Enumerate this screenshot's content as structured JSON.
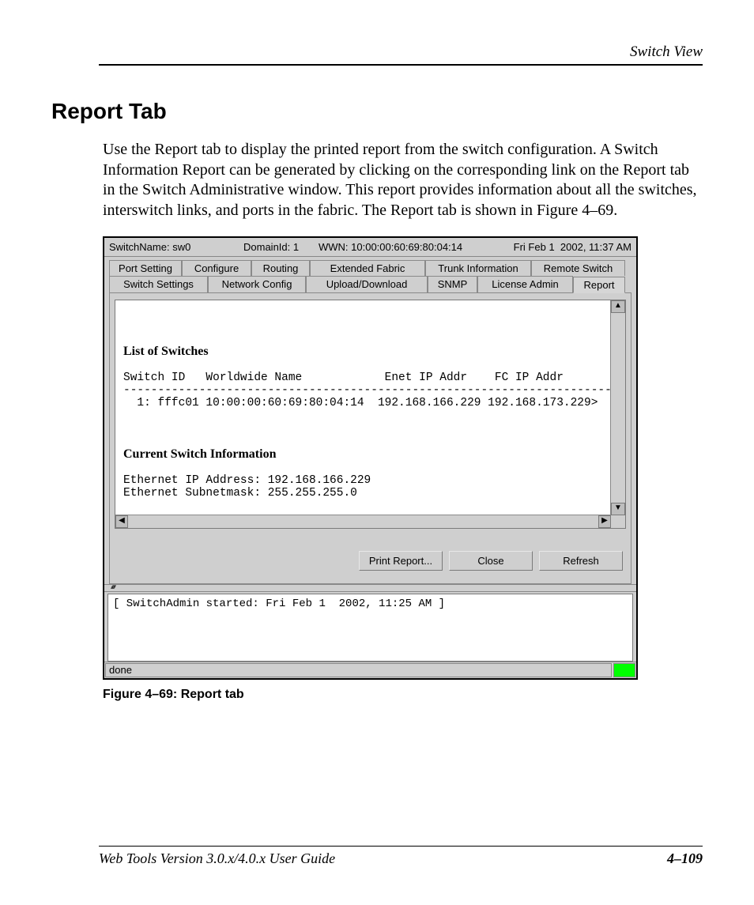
{
  "running_header": "Switch View",
  "section_title": "Report Tab",
  "body_text": "Use the Report tab to display the printed report from the switch configuration. A Switch Information Report can be generated by clicking on the corresponding link on the Report tab in the Switch Administrative window. This report provides information about all the switches, interswitch links, and ports in the fabric. The Report tab is shown in Figure 4–69.",
  "shot": {
    "switch_name_label": "SwitchName: sw0",
    "domain_label": "DomainId: 1",
    "wwn_label": "WWN: 10:00:00:60:69:80:04:14",
    "datetime_label": "Fri Feb 1  2002, 11:37 AM",
    "tabs_row1": [
      "Port Setting",
      "Configure",
      "Routing",
      "Extended Fabric",
      "Trunk Information",
      "Remote Switch"
    ],
    "tabs_row2": [
      "Switch Settings",
      "Network Config",
      "Upload/Download",
      "SNMP",
      "License Admin",
      "Report"
    ],
    "active_tab": "Report",
    "report": {
      "heading1": "List of Switches",
      "columns_line": "Switch ID   Worldwide Name            Enet IP Addr    FC IP Addr",
      "divider": "-------------------------------------------------------------------------",
      "row": "  1: fffc01 10:00:00:60:69:80:04:14  192.168.166.229 192.168.173.229>",
      "heading2": "Current Switch Information",
      "eth_ip_line": "Ethernet IP Address: 192.168.166.229",
      "eth_mask_line": "Ethernet Subnetmask: 255.255.255.0"
    },
    "buttons": {
      "print": "Print Report...",
      "close": "Close",
      "refresh": "Refresh"
    },
    "log_line": "[ SwitchAdmin started: Fri Feb 1  2002, 11:25 AM ]",
    "status_text": "done"
  },
  "figure_caption": "Figure 4–69:  Report tab",
  "footer_left": "Web Tools Version 3.0.x/4.0.x User Guide",
  "footer_right": "4–109"
}
